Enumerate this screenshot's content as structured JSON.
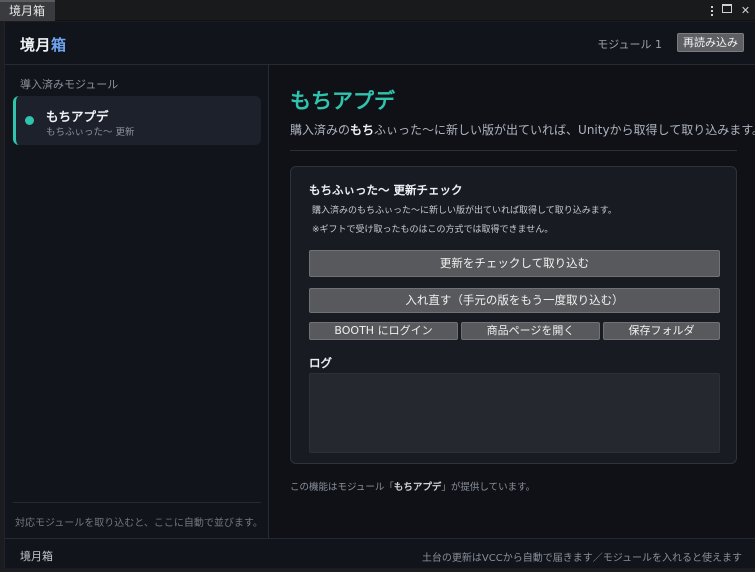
{
  "window": {
    "tab_title": "境月箱",
    "controls": [
      "more-icon",
      "maximize-icon",
      "close-icon"
    ],
    "close_glyph": "✕"
  },
  "header": {
    "brand_main": "境月",
    "brand_accent": "箱",
    "module_count": "モジュール 1",
    "reload_label": "再読み込み"
  },
  "sidebar": {
    "heading": "導入済みモジュール",
    "items": [
      {
        "name": "もちアプデ",
        "subtitle": "もちふぃった〜 更新",
        "active": true
      }
    ],
    "footer_note": "対応モジュールを取り込むと、ここに自動で並びます。"
  },
  "main": {
    "title": "もちアプデ",
    "description_pre": "購入済みの",
    "description_bold": "もち",
    "description_post": "ふぃった〜に新しい版が出ていれば、Unityから取得して取り込みます。",
    "card": {
      "title": "もちふぃった〜 更新チェック",
      "note1": "購入済みのもちふぃった〜に新しい版が出ていれば取得して取り込みます。",
      "note2": "※ギフトで受け取ったものはこの方式では取得できません。",
      "update_button": "更新をチェックして取り込む",
      "reinstall_button": "入れ直す（手元の版をもう一度取り込む）",
      "booth_login_button": "BOOTH にログイン",
      "store_page_button": "商品ページを開く",
      "save_folder_button": "保存フォルダ",
      "log_label": "ログ",
      "log_content": ""
    },
    "provider_pre": "この機能はモジュール「",
    "provider_name": "もちアプデ",
    "provider_post": "」が提供しています。"
  },
  "footer": {
    "brand": "境月箱",
    "note": "土台の更新はVCCから自動で届きます／モジュールを入れると使えます"
  },
  "colors": {
    "accent_teal": "#2fc4ae",
    "accent_blue": "#6fa4f2",
    "background": "#0f1117"
  }
}
